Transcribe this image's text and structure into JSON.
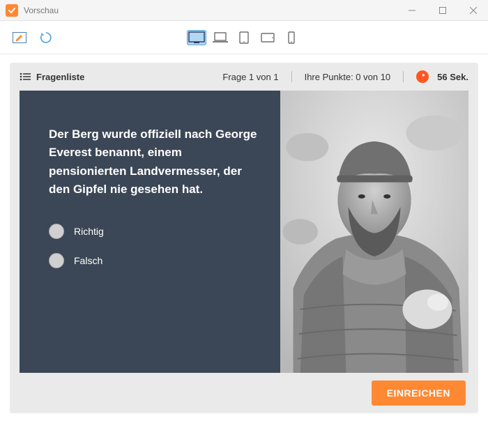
{
  "window": {
    "title": "Vorschau"
  },
  "quiz": {
    "question_list_label": "Fragenliste",
    "progress_label": "Frage 1 von 1",
    "score_label": "Ihre Punkte: 0 von 10",
    "timer_label": "56 Sek.",
    "question_text": "Der Berg wurde offiziell nach George Everest benannt, einem pensionierten Landvermesser, der den Gipfel nie gesehen hat.",
    "options": {
      "true_label": "Richtig",
      "false_label": "Falsch"
    },
    "submit_label": "EINREICHEN"
  }
}
